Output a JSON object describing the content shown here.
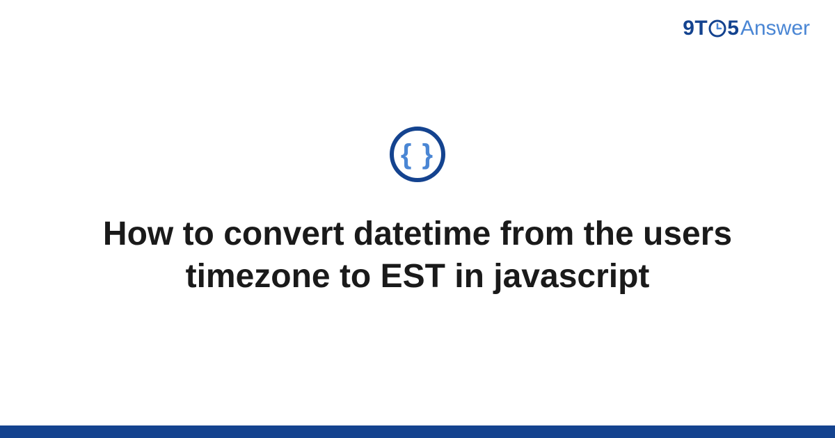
{
  "brand": {
    "prefix": "9T",
    "suffix": "5",
    "word": "Answer"
  },
  "topic": {
    "icon_name": "curly-braces-icon",
    "glyph": "{ }"
  },
  "title": "How to convert datetime from the users timezone to EST in javascript",
  "colors": {
    "primary": "#14438f",
    "accent": "#4a86d4"
  }
}
